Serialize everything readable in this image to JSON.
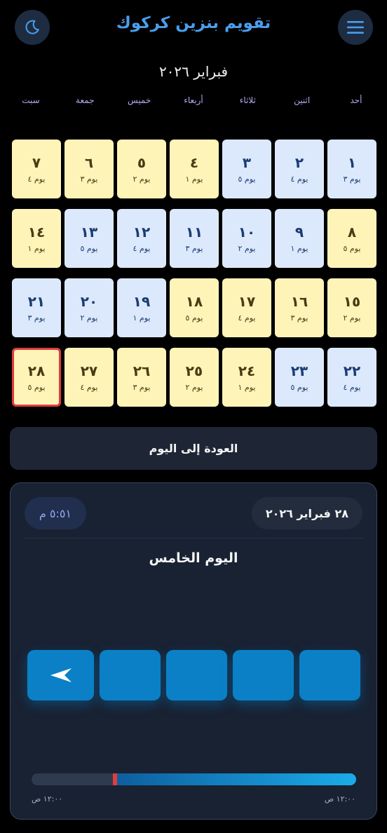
{
  "header": {
    "title": "تقويم بنزين كركوك",
    "menu_icon": "hamburger-icon",
    "theme_icon": "moon-icon"
  },
  "calendar": {
    "month_title": "فبراير ٢٠٢٦",
    "weekdays": [
      "أحد",
      "اثنين",
      "ثلاثاء",
      "أربعاء",
      "خميس",
      "جمعة",
      "سبت"
    ],
    "days": [
      {
        "num": "١",
        "sub": "يوم ٣",
        "color": "blue"
      },
      {
        "num": "٢",
        "sub": "يوم ٤",
        "color": "blue"
      },
      {
        "num": "٣",
        "sub": "يوم ٥",
        "color": "blue"
      },
      {
        "num": "٤",
        "sub": "يوم ١",
        "color": "yellow"
      },
      {
        "num": "٥",
        "sub": "يوم ٢",
        "color": "yellow"
      },
      {
        "num": "٦",
        "sub": "يوم ٣",
        "color": "yellow"
      },
      {
        "num": "٧",
        "sub": "يوم ٤",
        "color": "yellow"
      },
      {
        "num": "٨",
        "sub": "يوم ٥",
        "color": "yellow"
      },
      {
        "num": "٩",
        "sub": "يوم ١",
        "color": "blue"
      },
      {
        "num": "١٠",
        "sub": "يوم ٢",
        "color": "blue"
      },
      {
        "num": "١١",
        "sub": "يوم ٣",
        "color": "blue"
      },
      {
        "num": "١٢",
        "sub": "يوم ٤",
        "color": "blue"
      },
      {
        "num": "١٣",
        "sub": "يوم ٥",
        "color": "blue"
      },
      {
        "num": "١٤",
        "sub": "يوم ١",
        "color": "yellow"
      },
      {
        "num": "١٥",
        "sub": "يوم ٢",
        "color": "yellow"
      },
      {
        "num": "١٦",
        "sub": "يوم ٣",
        "color": "yellow"
      },
      {
        "num": "١٧",
        "sub": "يوم ٤",
        "color": "yellow"
      },
      {
        "num": "١٨",
        "sub": "يوم ٥",
        "color": "yellow"
      },
      {
        "num": "١٩",
        "sub": "يوم ١",
        "color": "blue"
      },
      {
        "num": "٢٠",
        "sub": "يوم ٢",
        "color": "blue"
      },
      {
        "num": "٢١",
        "sub": "يوم ٣",
        "color": "blue"
      },
      {
        "num": "٢٢",
        "sub": "يوم ٤",
        "color": "blue"
      },
      {
        "num": "٢٣",
        "sub": "يوم ٥",
        "color": "blue"
      },
      {
        "num": "٢٤",
        "sub": "يوم ١",
        "color": "yellow"
      },
      {
        "num": "٢٥",
        "sub": "يوم ٢",
        "color": "yellow"
      },
      {
        "num": "٢٦",
        "sub": "يوم ٣",
        "color": "yellow"
      },
      {
        "num": "٢٧",
        "sub": "يوم ٤",
        "color": "yellow"
      },
      {
        "num": "٢٨",
        "sub": "يوم ٥",
        "color": "yellow",
        "today": true
      }
    ],
    "back_to_today_label": "العودة إلى اليوم"
  },
  "panel": {
    "date": "٢٨ فبراير ٢٠٢٦",
    "time": "٥:٥١ م",
    "day_name": "اليوم الخامس",
    "slot_count": 5,
    "active_slot_icon": "arrow-left-icon",
    "progress_fraction": 0.25,
    "time_start": "١٢:٠٠ ص",
    "time_end": "١٢:٠٠ ص"
  },
  "colors": {
    "accent": "#4a9eec",
    "yellow_day": "#fff4b8",
    "blue_day": "#dce9fc",
    "today_border": "#e23c3c",
    "slot": "#0b80c6"
  }
}
